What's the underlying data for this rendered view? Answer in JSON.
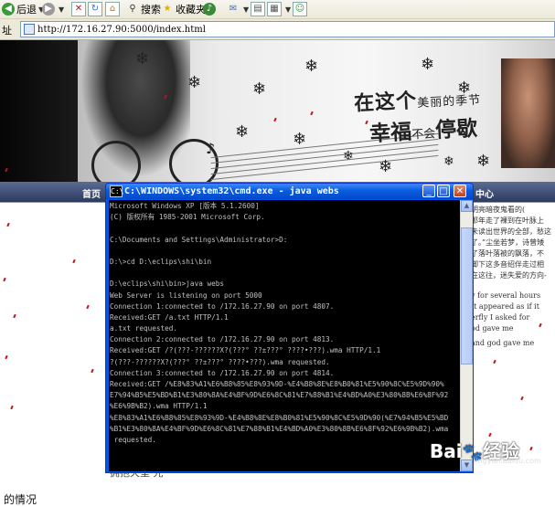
{
  "toolbar": {
    "back_label": "后退",
    "search_label": "搜索",
    "favorites_label": "收藏夹"
  },
  "address": {
    "label": "址",
    "url": "http://172.16.27.90:5000/index.html"
  },
  "banner": {
    "title_line1_a": "在这个",
    "title_line1_small": "美丽的季节",
    "title_line2_a": "幸福",
    "title_line2_small": "不会",
    "title_line2_b": "停歇"
  },
  "nav": {
    "home": "首页",
    "center": "中心"
  },
  "right_article": {
    "cn_lines": [
      "明亮暗夜鬼看的(",
      "那年走了裸到在叶脉上",
      "未读出世界的全部，愁这",
      "了。”尘坐若梦，诗曾矮",
      "了落叶落被的飘落，不",
      "脚下这多音绍伴走过相",
      "在这往，迷失爱的方向-"
    ],
    "en_lines": [
      "y for several hours",
      "It appeared as if it",
      "erfly I asked for",
      "od gave me"
    ],
    "footer_line": "and god gave me"
  },
  "cmd": {
    "title": "C:\\WINDOWS\\system32\\cmd.exe - java webs",
    "lines": [
      "Microsoft Windows XP [版本 5.1.2600]",
      "(C) 版权所有 1985-2001 Microsoft Corp.",
      "",
      "C:\\Documents and Settings\\Administrator>D:",
      "",
      "D:\\>cd D:\\eclips\\shi\\bin",
      "",
      "D:\\eclips\\shi\\bin>java webs",
      "Web Server is listening on port 5000",
      "Connection 1:connected to /172.16.27.90 on port 4807.",
      "Received:GET /a.txt HTTP/1.1",
      "a.txt requested.",
      "Connection 2:connected to /172.16.27.90 on port 4813.",
      "Received:GET /?(???-??????X?(???° ??±???° ????•???).wma HTTP/1.1",
      "?(???-??????X?(???° ??±???° ????•???).wma requested.",
      "Connection 3:connected to /172.16.27.90 on port 4814.",
      "Received:GET /%E8%83%A1%E6%B8%85%E8%93%9D-%E4%B8%8E%E8%B0%81%E5%90%8C%E5%9D%90%",
      "E7%94%B5%E5%BD%B1%E3%80%8A%E4%BF%9D%E6%8C%81%E7%88%B1%E4%BD%A0%E3%80%8B%E6%8F%92",
      "%E6%9B%B2).wma HTTP/1.1",
      "%E8%83%A1%E6%B8%85%E8%93%9D-%E4%B8%8E%E8%B0%81%E5%90%8C%E5%9D%90(%E7%94%B5%E5%BD",
      "%B1%E3%80%8A%E4%BF%9D%E6%8C%81%E7%88%B1%E4%BD%A0%E3%80%8B%E6%8F%92%E6%9B%B2).wma",
      " requested."
    ],
    "scroll_up": "▲",
    "scroll_down": "▼"
  },
  "page_bottom": {
    "partial_text": "拥抱天堂 光",
    "partial_text_2": "的情况"
  },
  "watermark": {
    "brand": "Bai",
    "brand_tail": "经验",
    "site": "jingyan.baidu.com"
  },
  "colors": {
    "cmd_bg": "#000000",
    "cmd_text": "#c0c0c0",
    "title_blue": "#0a5ce0",
    "nav_blue": "#2c3a5e",
    "accent_red": "#c0141c"
  }
}
